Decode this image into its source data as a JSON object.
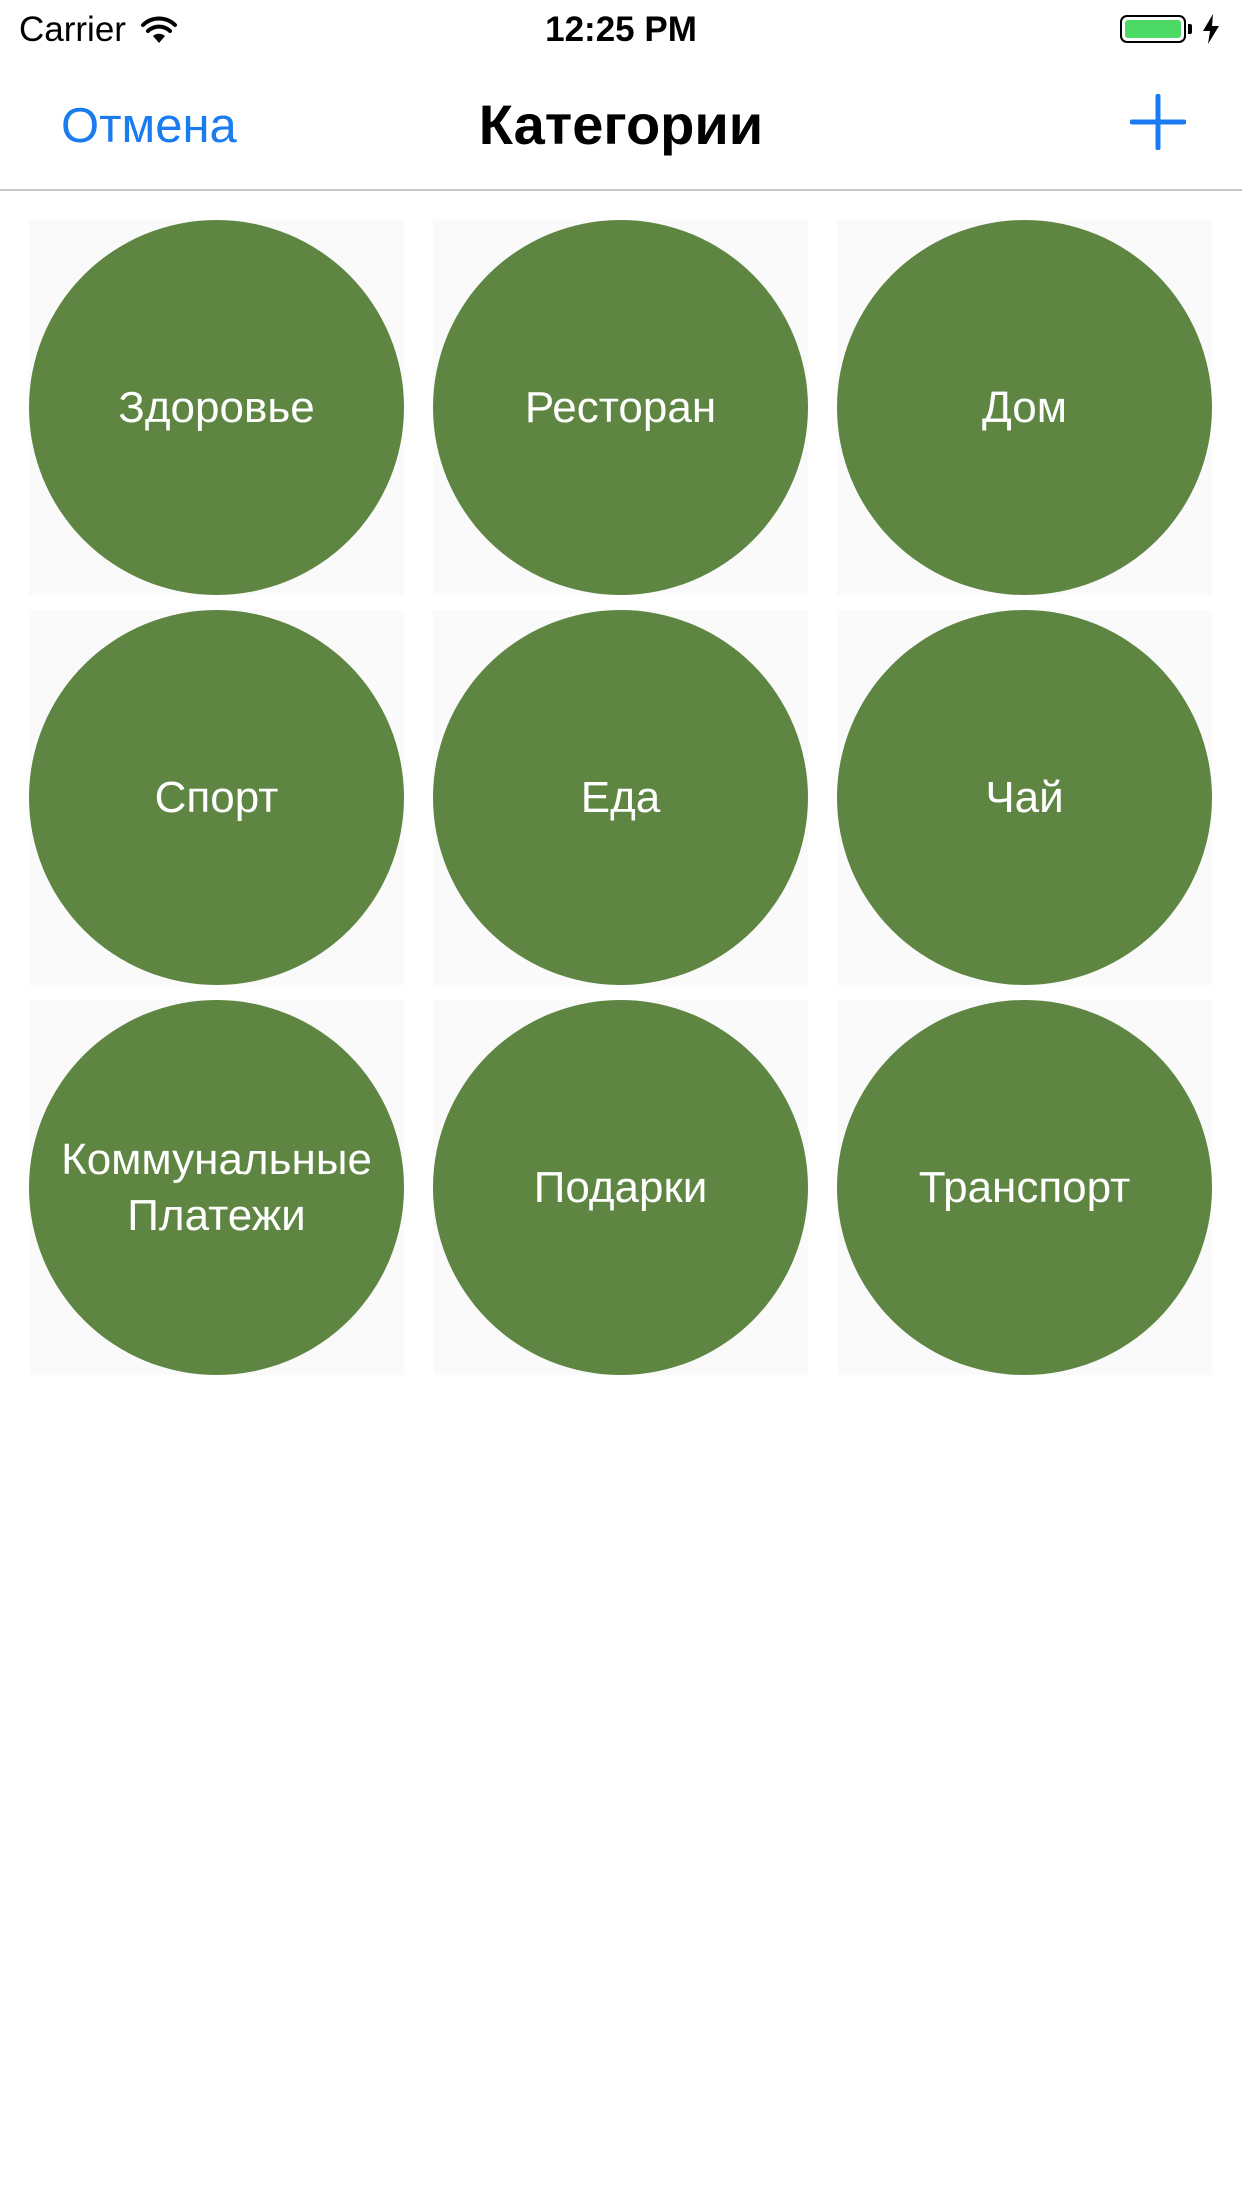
{
  "status_bar": {
    "carrier": "Carrier",
    "time": "12:25 PM",
    "battery_color": "#4cd964"
  },
  "nav": {
    "cancel_label": "Отмена",
    "title": "Категории",
    "add_icon": "plus-icon",
    "accent_color": "#1a7cf0"
  },
  "categories": [
    {
      "label": "Здоровье"
    },
    {
      "label": "Ресторан"
    },
    {
      "label": "Дом"
    },
    {
      "label": "Спорт"
    },
    {
      "label": "Еда"
    },
    {
      "label": "Чай"
    },
    {
      "label": "Коммунальные\nПлатежи"
    },
    {
      "label": "Подарки"
    },
    {
      "label": "Транспорт"
    }
  ],
  "category_color": "#5e8642"
}
